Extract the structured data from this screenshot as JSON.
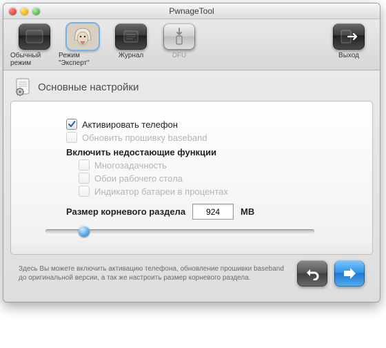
{
  "window": {
    "title": "PwnageTool"
  },
  "toolbar": {
    "items": [
      {
        "label": "Обычный режим"
      },
      {
        "label": "Режим \"Эксперт\""
      },
      {
        "label": "Журнал"
      },
      {
        "label": "DFU"
      }
    ],
    "exit_label": "Выход"
  },
  "section": {
    "title": "Основные настройки"
  },
  "options": {
    "activate_phone": "Активировать телефон",
    "update_baseband": "Обновить прошивку baseband",
    "enable_missing_heading": "Включить недостающие функции",
    "multitasking": "Многозадачность",
    "wallpapers": "Обои рабочего стола",
    "battery_percent": "Индикатор батареи в процентах"
  },
  "root_size": {
    "label": "Размер корневого раздела",
    "value": "924",
    "unit": "MB"
  },
  "hint": "Здесь Вы можете включить активацию телефона, обновление прошивки baseband до оригинальной версии, а так же настроить размер корневого раздела."
}
